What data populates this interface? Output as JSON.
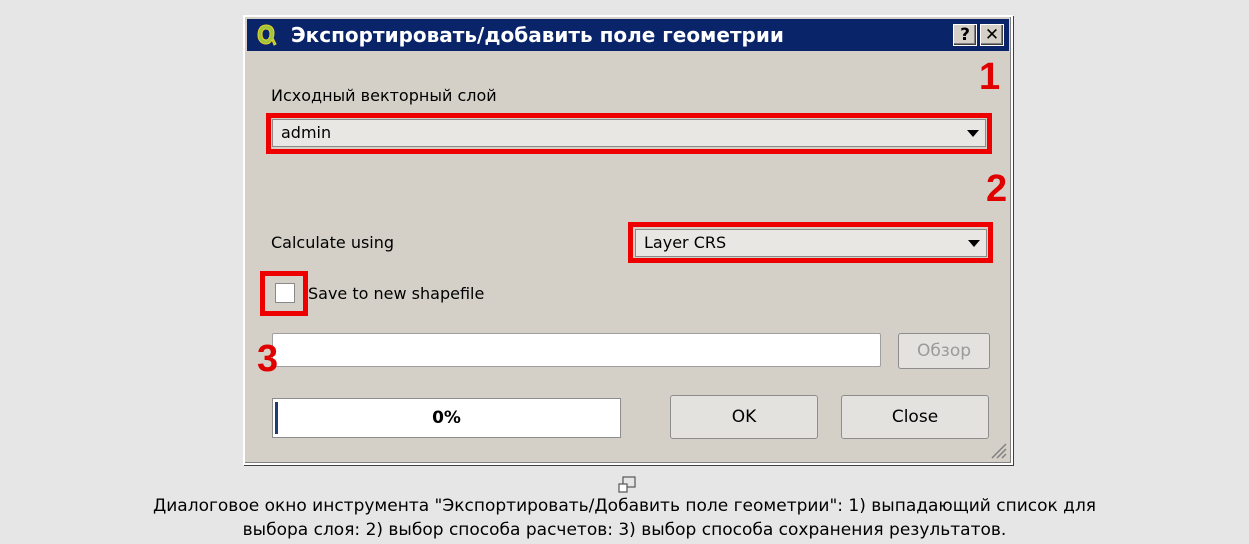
{
  "dialog": {
    "title": "Экспортировать/добавить поле геометрии",
    "title_buttons": {
      "help": "?",
      "close": "✕"
    },
    "source_layer_label": "Исходный векторный слой",
    "source_layer_value": "admin",
    "calculate_label": "Calculate using",
    "calculate_value": "Layer CRS",
    "save_checkbox_label": "Save to new shapefile",
    "save_checkbox_checked": false,
    "output_path_value": "",
    "browse_label": "Обзор",
    "progress_text": "0%",
    "progress_value": 0,
    "ok_label": "OK",
    "close_label": "Close"
  },
  "annotations": {
    "marker1": "1",
    "marker2": "2",
    "marker3": "3",
    "highlight_color": "#ee0000"
  },
  "caption": {
    "line1": "Диалоговое окно инструмента \"Экспортировать/Добавить поле геометрии\": 1) выпадающий список для",
    "line2": "выбора слоя: 2) выбор способа расчетов: 3) выбор способа сохранения результатов."
  },
  "icons": {
    "app": "qgis-icon",
    "resize": "resize-grip-icon",
    "expand": "expand-image-icon"
  },
  "colors": {
    "titlebar": "#0a246a",
    "dialog_bg": "#d4d0c8",
    "page_bg": "#e6e6e6",
    "progress_fill": "#203c74"
  }
}
